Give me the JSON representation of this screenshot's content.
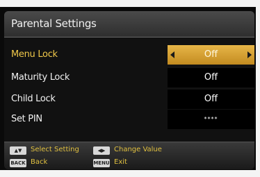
{
  "menu": {
    "title": "Parental Settings",
    "rows": [
      {
        "label": "Menu Lock",
        "value": "Off"
      },
      {
        "label": "Maturity Lock",
        "value": "Off"
      },
      {
        "label": "Child Lock",
        "value": "Off"
      },
      {
        "label": "Set PIN",
        "value": "****"
      }
    ]
  },
  "footer": {
    "hints": [
      {
        "key_icon": "updown-arrows-icon",
        "label": "Select Setting"
      },
      {
        "key_icon": "leftright-arrows-icon",
        "label": "Change Value"
      },
      {
        "key_icon": "back-key-icon",
        "label": "Back"
      },
      {
        "key_icon": "menu-key-icon",
        "label": "Exit"
      }
    ]
  },
  "colors": {
    "accent": "#e0b040",
    "panel": "#111111",
    "text": "#f2f2f2"
  }
}
